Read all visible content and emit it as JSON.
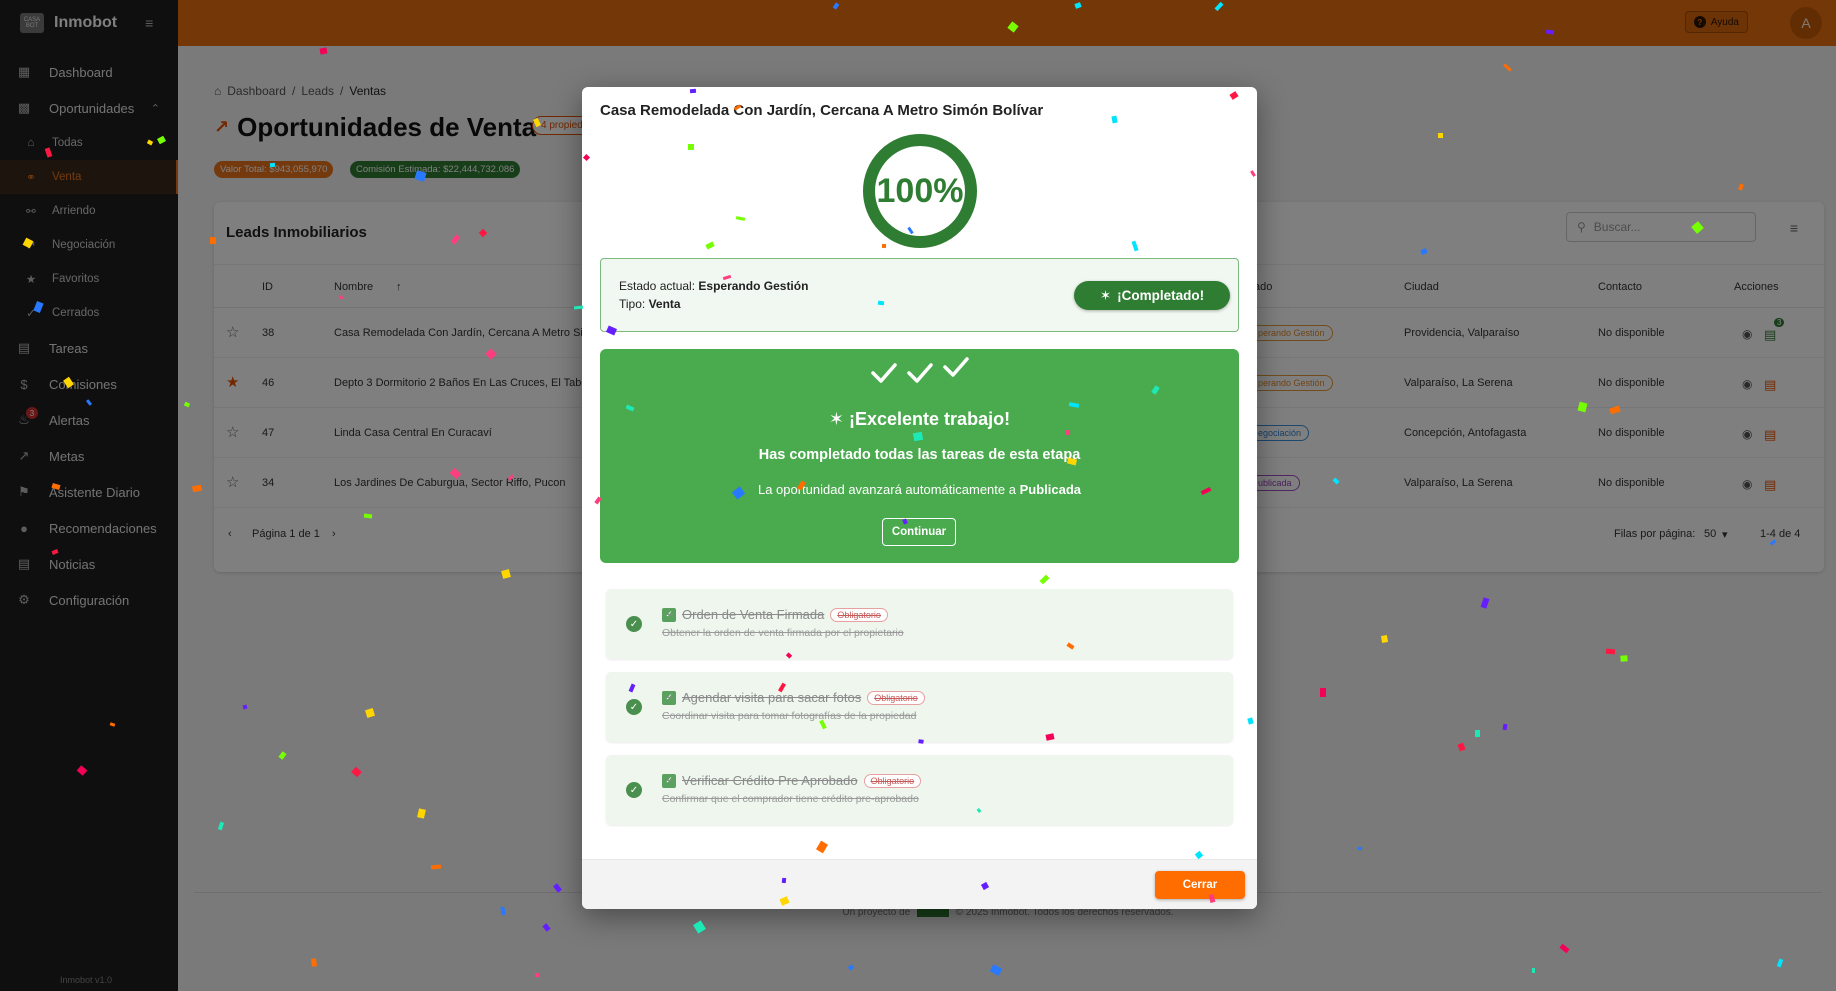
{
  "brand": {
    "name": "Inmobot",
    "logo_text": "CASA BOT",
    "version": "Inmobot v1.0"
  },
  "sidebar": {
    "items": [
      {
        "label": "Dashboard"
      },
      {
        "label": "Oportunidades"
      },
      {
        "label": "Tareas"
      },
      {
        "label": "Comisiones"
      },
      {
        "label": "Alertas",
        "badge": "3"
      },
      {
        "label": "Metas"
      },
      {
        "label": "Asistente Diario"
      },
      {
        "label": "Recomendaciones"
      },
      {
        "label": "Noticias"
      },
      {
        "label": "Configuración"
      }
    ],
    "sub_items": [
      {
        "label": "Todas"
      },
      {
        "label": "Venta"
      },
      {
        "label": "Arriendo"
      },
      {
        "label": "Negociación"
      },
      {
        "label": "Favoritos"
      },
      {
        "label": "Cerrados"
      }
    ]
  },
  "topbar": {
    "help_label": "Ayuda",
    "avatar_letter": "A"
  },
  "breadcrumb": {
    "items": [
      "Dashboard",
      "Leads",
      "Ventas"
    ]
  },
  "page": {
    "title": "Oportunidades de Venta",
    "count_chip": "4 propied",
    "total_value": "Valor Total: $943,055,970",
    "commission": "Comisión Estimada: $22,444,732.086"
  },
  "leads": {
    "title": "Leads Inmobiliarios",
    "search_placeholder": "Buscar...",
    "columns": {
      "id": "ID",
      "name": "Nombre",
      "status": "ado",
      "city": "Ciudad",
      "contact": "Contacto",
      "actions": "Acciones"
    },
    "rows": [
      {
        "id": "38",
        "name": "Casa Remodelada Con Jardín, Cercana A Metro Sim",
        "status": "perando Gestión",
        "city": "Providencia, Valparaíso",
        "contact": "No disponible",
        "badge": "3"
      },
      {
        "id": "46",
        "name": "Depto 3 Dormitorio 2 Baños En Las Cruces, El Tabo",
        "status": "perando Gestión",
        "city": "Valparaíso, La Serena",
        "contact": "No disponible"
      },
      {
        "id": "47",
        "name": "Linda Casa Central En Curacaví",
        "status": "egociación",
        "city": "Concepción, Antofagasta",
        "contact": "No disponible"
      },
      {
        "id": "34",
        "name": "Los Jardines De Caburgua, Sector Riffo, Pucon",
        "status": "ublicada",
        "city": "Valparaíso, La Serena",
        "contact": "No disponible"
      }
    ],
    "pager": {
      "page": "Página 1 de 1",
      "rows_per_page": "Filas por página:",
      "rows_value": "50",
      "range": "1-4 de 4"
    }
  },
  "footer": {
    "text_before": "Un proyecto de",
    "text_after": "© 2025 Inmobot. Todos los derechos reservados."
  },
  "modal": {
    "title": "Casa Remodelada Con Jardín, Cercana A Metro Simón Bolívar",
    "progress": "100%",
    "progress_fraction": 1.0,
    "status_label": "Estado actual:",
    "status_value": "Esperando Gestión",
    "type_label": "Tipo:",
    "type_value": "Venta",
    "completed_label": "¡Completado!",
    "success_title": "¡Excelente trabajo!",
    "success_subtitle": "Has completado todas las tareas de esta etapa",
    "success_info": "La oportunidad avanzará automáticamente a",
    "success_next_stage": "Publicada",
    "continue_label": "Continuar",
    "tasks": [
      {
        "title": "Orden de Venta Firmada",
        "tag": "Obligatorio",
        "desc": "Obtener la orden de venta firmada por el propietario"
      },
      {
        "title": "Agendar visita para sacar fotos",
        "tag": "Obligatorio",
        "desc": "Coordinar visita para tomar fotografías de la propiedad"
      },
      {
        "title": "Verificar Crédito Pre Aprobado",
        "tag": "Obligatorio",
        "desc": "Confirmar que el comprador tiene crédito pre-aprobado"
      }
    ],
    "close_label": "Cerrar"
  },
  "colors": {
    "primary": "#e76e10",
    "success": "#2e7d32",
    "success_box": "#4aaa4e",
    "sidebar": "#1e1e1e",
    "close_button": "#ff6d00"
  }
}
